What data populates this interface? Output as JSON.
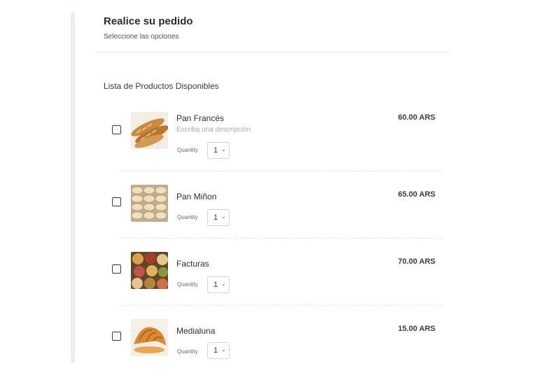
{
  "header": {
    "title": "Realice su pedido",
    "subtitle": "Seleccione las opciones"
  },
  "section_title": "Lista de Productos Disponibles",
  "quantity_label": "Quantity",
  "products": [
    {
      "name": "Pan Francés",
      "description": "Escriba una descripción",
      "quantity": "1",
      "price": "60.00 ARS",
      "checked": false,
      "image": "baguette-image"
    },
    {
      "name": "Pan Miñon",
      "description": "",
      "quantity": "1",
      "price": "65.00 ARS",
      "checked": false,
      "image": "bread-rolls-image"
    },
    {
      "name": "Facturas",
      "description": "",
      "quantity": "1",
      "price": "70.00 ARS",
      "checked": false,
      "image": "pastries-image"
    },
    {
      "name": "Medialuna",
      "description": "",
      "quantity": "1",
      "price": "15.00 ARS",
      "checked": false,
      "image": "croissant-image"
    }
  ]
}
